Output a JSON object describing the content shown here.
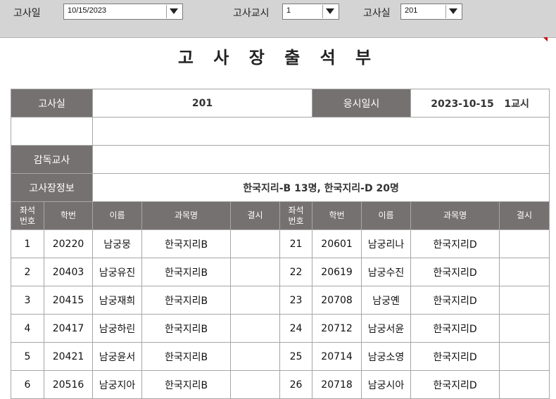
{
  "filters": {
    "date_label": "고사일",
    "date_value": "10/15/2023",
    "period_label": "고사교시",
    "period_value": "1",
    "room_label": "고사실",
    "room_value": "201"
  },
  "title": "고 사 장 출 석 부",
  "info": {
    "room_header": "고사실",
    "room_value": "201",
    "datetime_header": "응시일시",
    "datetime_value": "2023-10-15   1교시",
    "proctor_header": "감독교사",
    "proctor_value": "",
    "site_header": "고사장정보",
    "site_value": "한국지리-B 13명, 한국지리-D 20명"
  },
  "columns": {
    "seat_line1": "좌석",
    "seat_line2": "번호",
    "student_id": "학번",
    "name": "이름",
    "subject": "과목명",
    "absent": "결시"
  },
  "rows": [
    {
      "l_seat": "1",
      "l_id": "20220",
      "l_name": "남궁뭉",
      "l_subject": "한국지리B",
      "l_absent": "",
      "r_seat": "21",
      "r_id": "20601",
      "r_name": "남궁리나",
      "r_subject": "한국지리D",
      "r_absent": ""
    },
    {
      "l_seat": "2",
      "l_id": "20403",
      "l_name": "남궁유진",
      "l_subject": "한국지리B",
      "l_absent": "",
      "r_seat": "22",
      "r_id": "20619",
      "r_name": "남궁수진",
      "r_subject": "한국지리D",
      "r_absent": ""
    },
    {
      "l_seat": "3",
      "l_id": "20415",
      "l_name": "남궁재희",
      "l_subject": "한국지리B",
      "l_absent": "",
      "r_seat": "23",
      "r_id": "20708",
      "r_name": "남궁옌",
      "r_subject": "한국지리D",
      "r_absent": ""
    },
    {
      "l_seat": "4",
      "l_id": "20417",
      "l_name": "남궁하린",
      "l_subject": "한국지리B",
      "l_absent": "",
      "r_seat": "24",
      "r_id": "20712",
      "r_name": "남궁서윤",
      "r_subject": "한국지리D",
      "r_absent": ""
    },
    {
      "l_seat": "5",
      "l_id": "20421",
      "l_name": "남궁윤서",
      "l_subject": "한국지리B",
      "l_absent": "",
      "r_seat": "25",
      "r_id": "20714",
      "r_name": "남궁소영",
      "r_subject": "한국지리D",
      "r_absent": ""
    },
    {
      "l_seat": "6",
      "l_id": "20516",
      "l_name": "남궁지아",
      "l_subject": "한국지리B",
      "l_absent": "",
      "r_seat": "26",
      "r_id": "20718",
      "r_name": "남궁시아",
      "r_subject": "한국지리D",
      "r_absent": ""
    }
  ],
  "colors": {
    "header_bg": "#767171",
    "toolbar_bg": "#d4d4d4",
    "grid_line": "#a6a6a6"
  }
}
